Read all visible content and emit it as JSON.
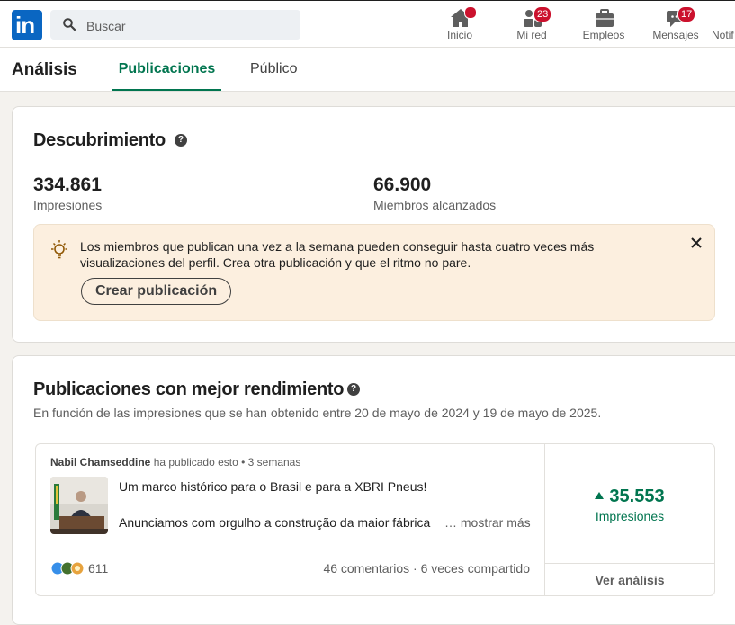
{
  "nav": {
    "logo_text": "in",
    "search_placeholder": "Buscar",
    "items": [
      {
        "label": "Inicio",
        "icon": "home-icon",
        "badge": ""
      },
      {
        "label": "Mi red",
        "icon": "people-icon",
        "badge": "23"
      },
      {
        "label": "Empleos",
        "icon": "briefcase-icon",
        "badge": ""
      },
      {
        "label": "Mensajes",
        "icon": "messaging-icon",
        "badge": "17"
      },
      {
        "label": "Notif",
        "icon": "bell-icon",
        "badge": ""
      }
    ]
  },
  "header": {
    "title": "Análisis",
    "tabs": [
      {
        "label": "Publicaciones",
        "active": true
      },
      {
        "label": "Público",
        "active": false
      }
    ]
  },
  "discovery": {
    "title": "Descubrimiento",
    "help": "?",
    "metrics": [
      {
        "value": "334.861",
        "label": "Impresiones"
      },
      {
        "value": "66.900",
        "label": "Miembros alcanzados"
      }
    ],
    "tip": {
      "text": "Los miembros que publican una vez a la semana pueden conseguir hasta cuatro veces más visualizaciones del perfil. Crea otra publicación y que el ritmo no pare.",
      "button": "Crear publicación"
    }
  },
  "top_posts": {
    "title": "Publicaciones con mejor rendimiento",
    "help": "?",
    "subtitle": "En función de las impresiones que se han obtenido entre 20 de mayo de 2024 y 19 de mayo de 2025.",
    "post": {
      "author": "Nabil Chamseddine",
      "action": "ha publicado esto",
      "time": "• 3 semanas",
      "line1": "Um marco histórico para o Brasil e para a XBRI Pneus!",
      "line2": "Anunciamos com orgulho a construção da maior fábrica",
      "more": "… mostrar más",
      "reactions": "611",
      "stats": "46 comentarios · 6 veces compartido",
      "impressions_value": "35.553",
      "impressions_label": "Impresiones",
      "analysis_button": "Ver análisis"
    }
  },
  "colors": {
    "brand": "#0a66c2",
    "accent_green": "#01754f",
    "badge_red": "#cb112d",
    "tip_bg": "#fcefdf"
  }
}
